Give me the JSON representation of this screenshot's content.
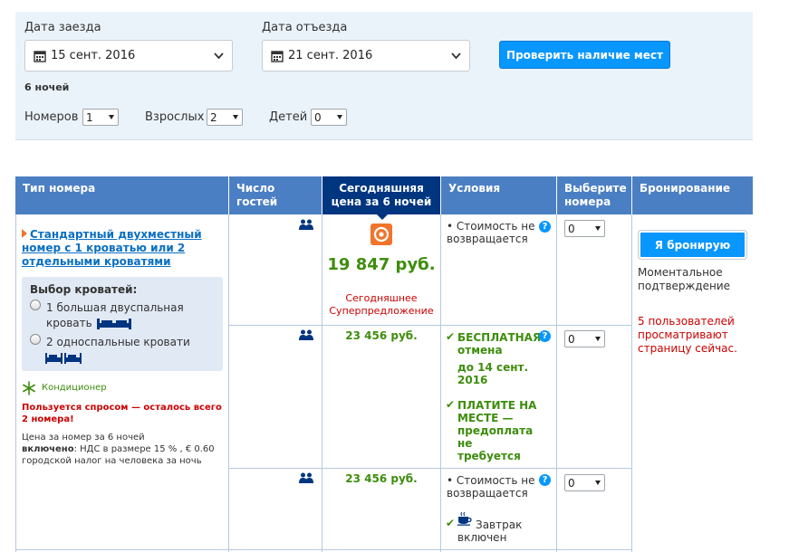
{
  "search": {
    "checkin_label": "Дата заезда",
    "checkin_value": "15 сент. 2016",
    "checkout_label": "Дата отъезда",
    "checkout_value": "21 сент. 2016",
    "check_button": "Проверить наличие мест",
    "nights": "6 ночей",
    "rooms_label": "Номеров",
    "rooms_value": "1",
    "adults_label": "Взрослых",
    "adults_value": "2",
    "children_label": "Детей",
    "children_value": "0"
  },
  "table": {
    "headers": {
      "room_type": "Тип номера",
      "guests": "Число гостей",
      "price": "Сегодняшняя цена за 6 ночей",
      "conditions": "Условия",
      "select": "Выберите номера",
      "booking": "Бронирование"
    },
    "room": {
      "name": "Стандартный двухместный номер с 1 кроватью или 2 отдельными кроватями",
      "beds_title": "Выбор кроватей:",
      "bed_option_1": "1 большая двуспальная кровать",
      "bed_option_2": "2 односпальные кровати",
      "amenity": "Кондиционер",
      "demand": "Пользуется спросом — осталось всего 2 номера!",
      "price_note": "Цена за номер за 6 ночей",
      "included_label": "включено",
      "included_text": ": НДС в размере 15 % , € 0.60 городской налог на человека за ночь"
    },
    "rows": [
      {
        "price": "19 847 руб.",
        "deal": "Сегодняшнее Суперпредложение",
        "condition": "Стоимость не возвращается",
        "qty": "0"
      },
      {
        "price": "23 456 руб.",
        "free_cancel": "БЕСПЛАТНАЯ отмена",
        "cancel_until": "до 14 сент. 2016",
        "pay_at_hotel": "ПЛАТИТЕ НА МЕСТЕ — предоплата не требуется",
        "qty": "0"
      },
      {
        "price": "23 456 руб.",
        "condition": "Стоимость не возвращается",
        "breakfast": "Завтрак включен",
        "qty": "0"
      }
    ],
    "booking": {
      "button": "Я бронирую",
      "instant": "Моментальное подтверждение",
      "viewers": "5 пользователей просматривают страницу сейчас."
    }
  },
  "colors": {
    "header_blue": "#4b7fc3",
    "header_dark": "#003580",
    "button_blue": "#0896ff",
    "green": "#3e8d0d",
    "red": "#cc0000",
    "deal_orange": "#f0742b"
  }
}
